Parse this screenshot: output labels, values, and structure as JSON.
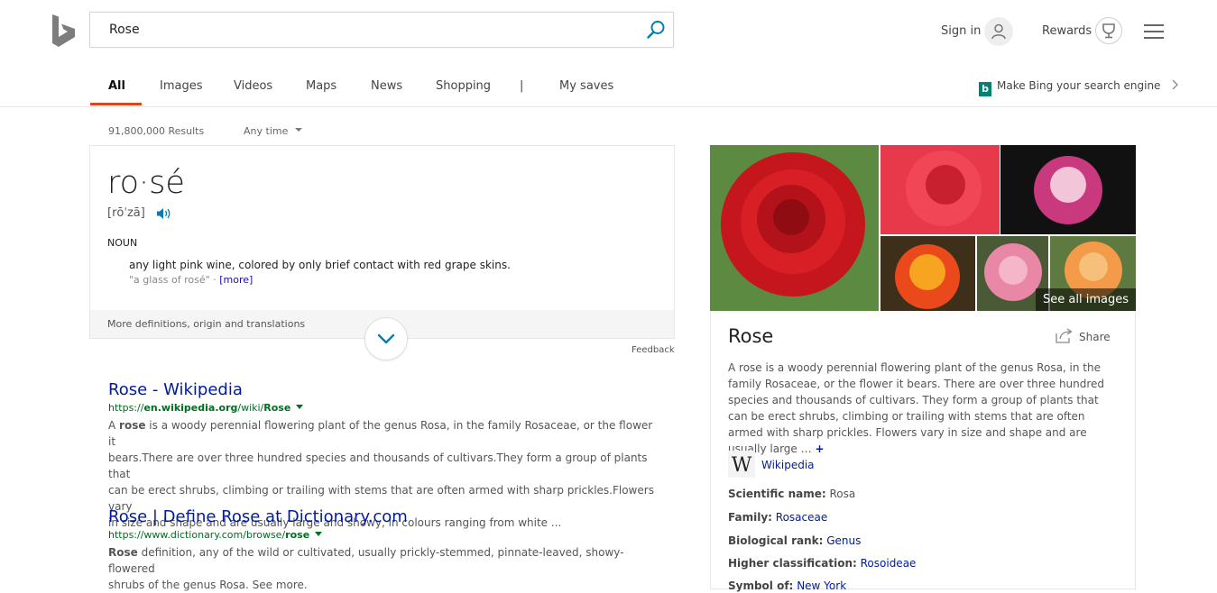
{
  "header": {
    "search_value": "Rose",
    "sign_in": "Sign in",
    "rewards": "Rewards"
  },
  "nav": {
    "tabs": [
      "All",
      "Images",
      "Videos",
      "Maps",
      "News",
      "Shopping",
      "|",
      "My saves"
    ],
    "active": "All",
    "make_bing": "Make Bing your search engine"
  },
  "meta": {
    "results_count": "91,800,000 Results",
    "time_filter": "Any time"
  },
  "dictionary": {
    "word": "ro·sé",
    "pronunciation": "[rōˈzā]",
    "part_of_speech": "NOUN",
    "definition": "any light pink wine, colored by only brief contact with red grape skins.",
    "example": "\"a glass of rosé\" · ",
    "more": "[more]",
    "footer": "More definitions, origin and translations",
    "feedback": "Feedback"
  },
  "results": [
    {
      "title": "Rose - Wikipedia",
      "url_prefix": "https://",
      "url_bold": "en.wikipedia.org",
      "url_mid": "/wiki/",
      "url_end": "Rose",
      "snippet_lines": [
        [
          "A ",
          "rose",
          " is a woody perennial flowering plant of the genus Rosa, in the family Rosaceae, or the flower it"
        ],
        [
          "",
          "",
          "bears.There are over three hundred species and thousands of cultivars.They form a group of plants that"
        ],
        [
          "",
          "",
          "can be erect shrubs, climbing or trailing with stems that are often armed with sharp prickles.Flowers vary"
        ],
        [
          "",
          "",
          "in size and shape and are usually large and showy, in colours ranging from white ..."
        ]
      ]
    },
    {
      "title": "Rose | Define Rose at Dictionary.com",
      "url_prefix": "https://www.dictionary.com/browse/",
      "url_bold": "",
      "url_mid": "",
      "url_end": "rose",
      "snippet_lines": [
        [
          "",
          "Rose",
          " definition, any of the wild or cultivated, usually prickly-stemmed, pinnate-leaved, showy-flowered"
        ],
        [
          "",
          "",
          "shrubs of the genus Rosa. See more."
        ]
      ]
    }
  ],
  "knowledge_panel": {
    "see_all": "See all images",
    "title": "Rose",
    "share": "Share",
    "description": "A rose is a woody perennial flowering plant of the genus Rosa, in the family Rosaceae, or the flower it bears. There are over three hundred species and thousands of cultivars. They form a group of plants that can be erect shrubs, climbing or trailing with stems that are often armed with sharp prickles. Flowers vary in size and shape and are usually large …",
    "plus": "+",
    "wiki_label": "Wikipedia",
    "facts": [
      {
        "label": "Scientific name:",
        "value": "Rosa",
        "link": false
      },
      {
        "label": "Family:",
        "value": "Rosaceae",
        "link": true
      },
      {
        "label": "Biological rank:",
        "value": "Genus",
        "link": true
      },
      {
        "label": "Higher classification:",
        "value": "Rosoideae",
        "link": true
      },
      {
        "label": "Symbol of:",
        "value": "New York",
        "link": true
      }
    ]
  },
  "colors": {
    "accent": "#d34a1f",
    "link": "#001ba0",
    "url_green": "#006d21",
    "bing_teal": "#008373"
  }
}
